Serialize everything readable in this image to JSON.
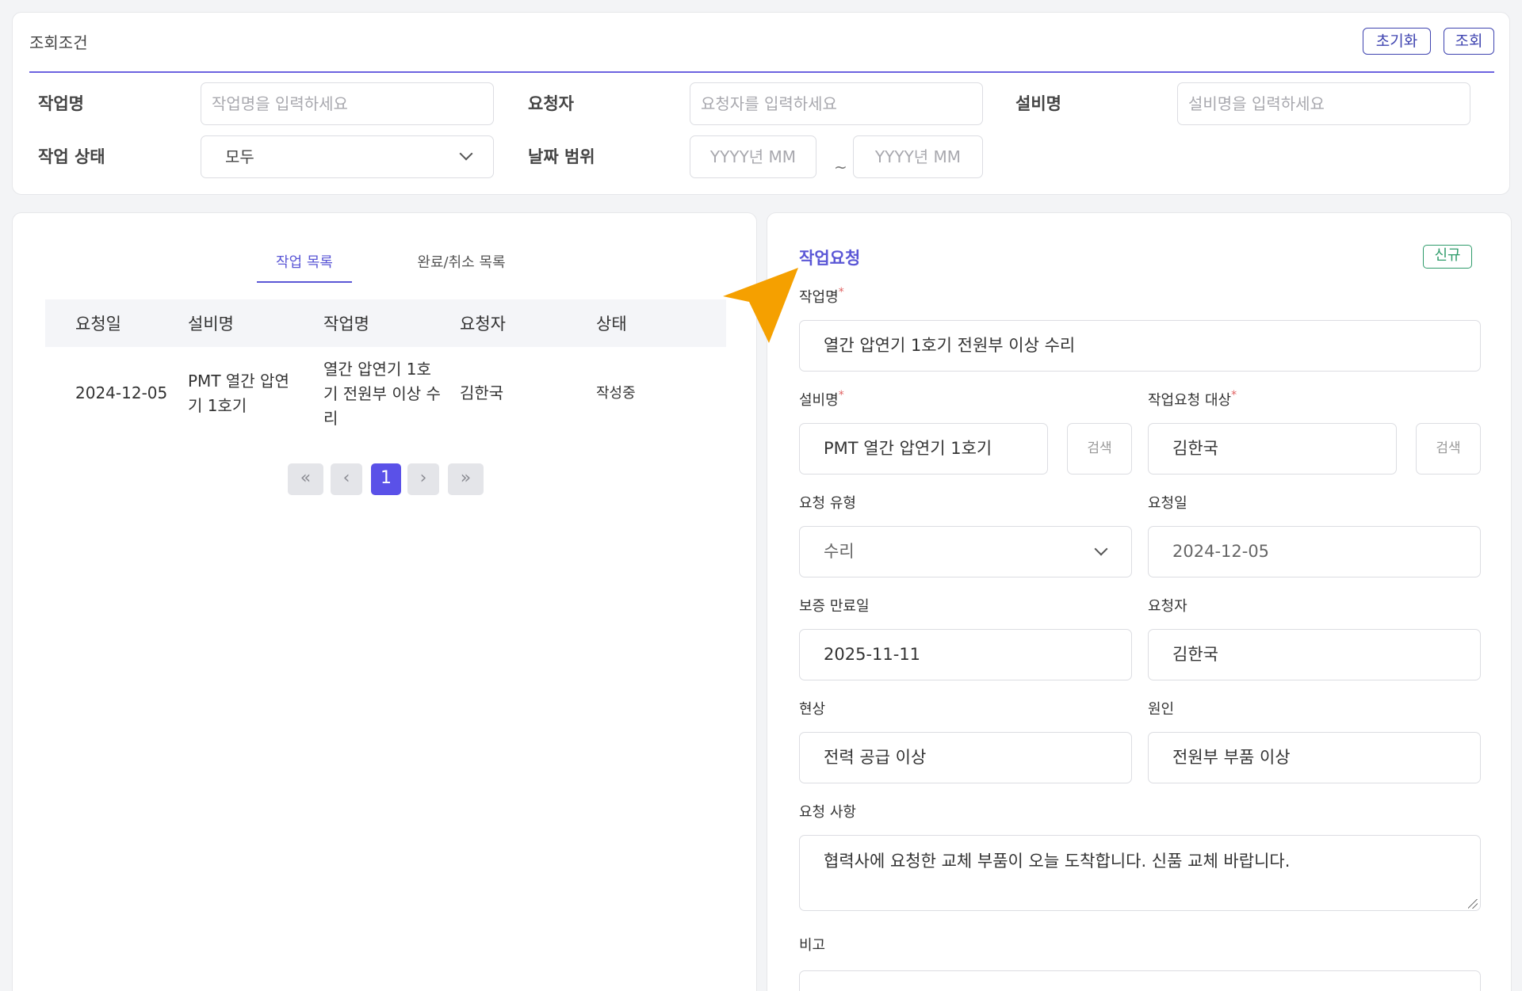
{
  "search": {
    "title": "조회조건",
    "reset_label": "초기화",
    "search_label": "조회",
    "work_name_label": "작업명",
    "work_name_placeholder": "작업명을 입력하세요",
    "requester_label": "요청자",
    "requester_placeholder": "요청자를 입력하세요",
    "equipment_label": "설비명",
    "equipment_placeholder": "설비명을 입력하세요",
    "status_label": "작업 상태",
    "status_value": "모두",
    "date_range_label": "날짜 범위",
    "date_from_placeholder": "YYYY년 MM",
    "date_to_placeholder": "YYYY년 MM",
    "date_separator": "~"
  },
  "list": {
    "tabs": [
      {
        "label": "작업 목록",
        "active": true
      },
      {
        "label": "완료/취소 목록",
        "active": false
      }
    ],
    "columns": [
      "요청일",
      "설비명",
      "작업명",
      "요청자",
      "상태"
    ],
    "rows": [
      {
        "date": "2024-12-05",
        "equipment": "PMT 열간 압연기 1호기",
        "work": "열간 압연기 1호기 전원부 이상 수리",
        "requester": "김한국",
        "status": "작성중"
      }
    ],
    "pagination": {
      "first": "«",
      "prev": "‹",
      "current": "1",
      "next": "›",
      "last": "»"
    }
  },
  "detail": {
    "title": "작업요청",
    "badge": "신규",
    "work_name_label": "작업명",
    "work_name_value": "열간 압연기 1호기 전원부 이상 수리",
    "equipment_label": "설비명",
    "equipment_value": "PMT 열간 압연기 1호기",
    "equipment_search": "검색",
    "target_label": "작업요청 대상",
    "target_value": "김한국",
    "target_search": "검색",
    "request_type_label": "요청 유형",
    "request_type_value": "수리",
    "request_date_label": "요청일",
    "request_date_value": "2024-12-05",
    "warranty_label": "보증 만료일",
    "warranty_value": "2025-11-11",
    "requester_label": "요청자",
    "requester_value": "김한국",
    "symptom_label": "현상",
    "symptom_value": "전력 공급 이상",
    "cause_label": "원인",
    "cause_value": "전원부 부품 이상",
    "request_details_label": "요청 사항",
    "request_details_value": "협력사에 요청한 교체 부품이 오늘 도착합니다. 신품 교체 바랍니다.",
    "remarks_label": "비고",
    "required_mark": "*"
  },
  "colors": {
    "accent": "#5b57d6",
    "primary_button": "#3f44b0",
    "badge_green": "#2e9b6a",
    "pager_active": "#5a51e8",
    "cursor": "#f5a000"
  }
}
